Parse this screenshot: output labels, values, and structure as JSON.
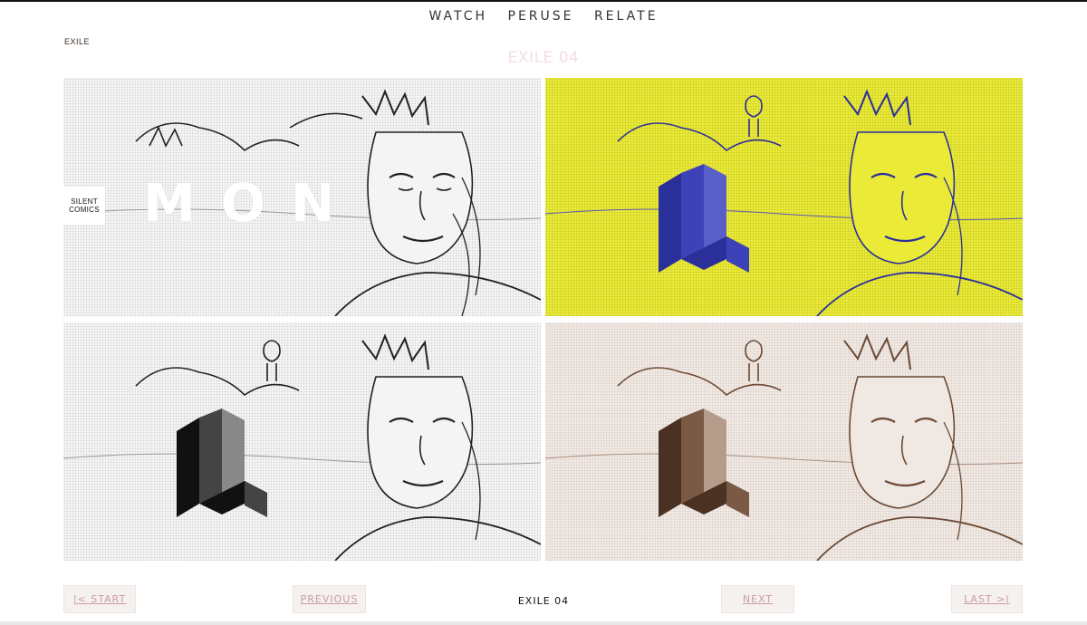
{
  "nav": {
    "items": [
      "WATCH",
      "PERUSE",
      "RELATE"
    ]
  },
  "breadcrumb": "EXILE",
  "title": "EXILE 04",
  "panels": {
    "p1": {
      "badge_line1": "SILENT",
      "badge_line2": "COMICS",
      "overlay_text": "MON"
    },
    "p2": {},
    "p3": {},
    "p4": {}
  },
  "pager": {
    "start": "|< START",
    "previous": "PREVIOUS",
    "current": "EXILE 04",
    "next": "NEXT",
    "last": "LAST >|"
  },
  "colors": {
    "yellow_panel": "#eaea37",
    "blue_ink": "#2b2f9a",
    "sepia_ink": "#6b4a35",
    "title_pink": "#f3dde3",
    "button_text": "#c99aa4"
  }
}
